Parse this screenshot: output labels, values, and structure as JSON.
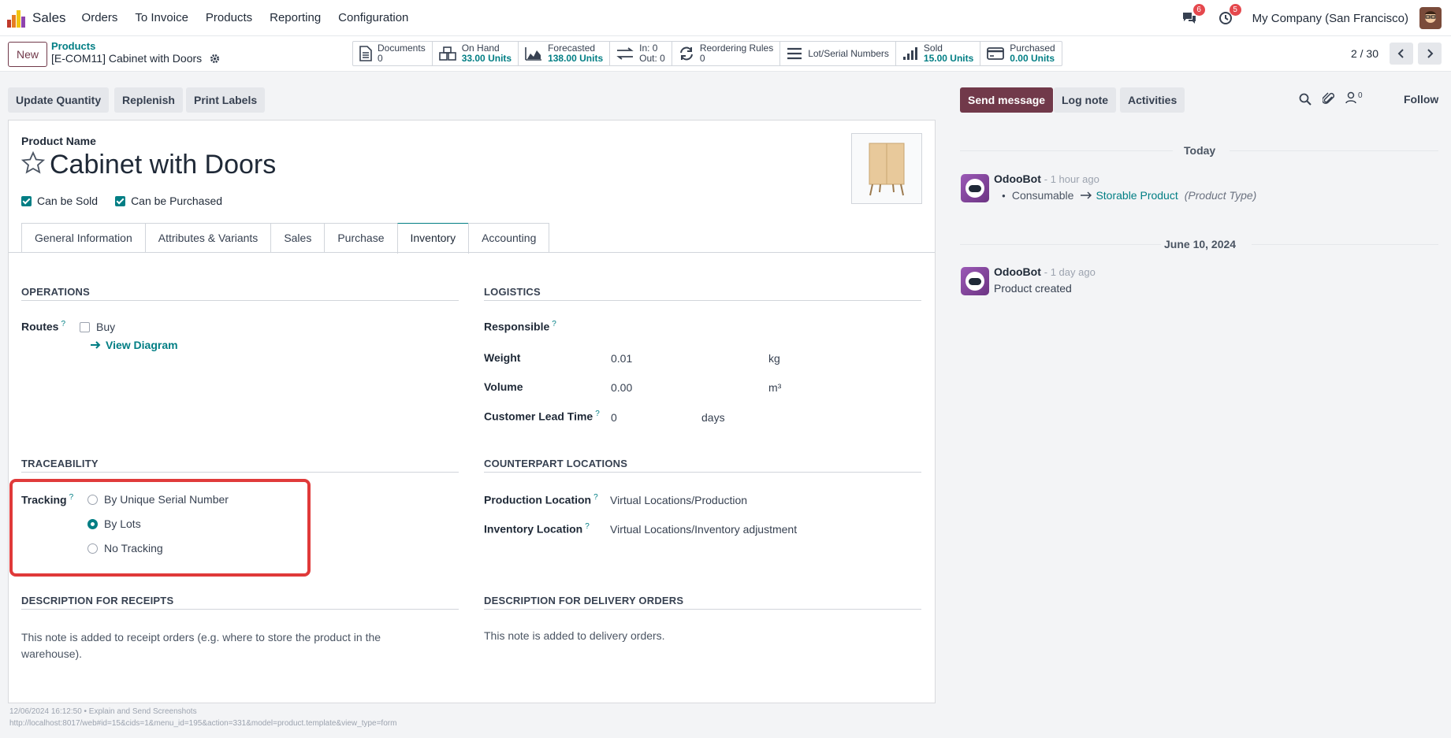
{
  "navbar": {
    "app_name": "Sales",
    "menu": [
      "Orders",
      "To Invoice",
      "Products",
      "Reporting",
      "Configuration"
    ],
    "messages_badge": "6",
    "activities_badge": "5",
    "company": "My Company (San Francisco)"
  },
  "control": {
    "new_label": "New",
    "breadcrumb_parent": "Products",
    "breadcrumb_current": "[E-COM11] Cabinet with Doors",
    "smart_buttons": {
      "documents": {
        "label": "Documents",
        "value": "0"
      },
      "on_hand": {
        "label": "On Hand",
        "value": "33.00 Units"
      },
      "forecasted": {
        "label": "Forecasted",
        "value": "138.00 Units"
      },
      "in_out": {
        "in": "In: 0",
        "out": "Out: 0"
      },
      "reordering": {
        "label": "Reordering Rules",
        "value": "0"
      },
      "lots": {
        "label": "Lot/Serial Numbers"
      },
      "sold": {
        "label": "Sold",
        "value": "15.00 Units"
      },
      "purchased": {
        "label": "Purchased",
        "value": "0.00 Units"
      }
    },
    "pager": "2 / 30"
  },
  "actions": {
    "update_quantity": "Update Quantity",
    "replenish": "Replenish",
    "print_labels": "Print Labels"
  },
  "form": {
    "product_name_label": "Product Name",
    "product_name": "Cabinet with Doors",
    "can_be_sold": "Can be Sold",
    "can_be_purchased": "Can be Purchased",
    "tabs": [
      "General Information",
      "Attributes & Variants",
      "Sales",
      "Purchase",
      "Inventory",
      "Accounting"
    ],
    "active_tab": "Inventory",
    "operations": {
      "title": "OPERATIONS",
      "routes_label": "Routes",
      "route_buy": "Buy",
      "view_diagram": "View Diagram"
    },
    "logistics": {
      "title": "LOGISTICS",
      "responsible_label": "Responsible",
      "weight_label": "Weight",
      "weight_value": "0.01",
      "weight_unit": "kg",
      "volume_label": "Volume",
      "volume_value": "0.00",
      "volume_unit": "m³",
      "lead_time_label": "Customer Lead Time",
      "lead_time_value": "0",
      "lead_time_unit": "days"
    },
    "traceability": {
      "title": "TRACEABILITY",
      "tracking_label": "Tracking",
      "options": [
        "By Unique Serial Number",
        "By Lots",
        "No Tracking"
      ],
      "selected": "By Lots"
    },
    "counterpart": {
      "title": "COUNTERPART LOCATIONS",
      "production_label": "Production Location",
      "production_value": "Virtual Locations/Production",
      "inventory_label": "Inventory Location",
      "inventory_value": "Virtual Locations/Inventory adjustment"
    },
    "desc_receipts": {
      "title": "DESCRIPTION FOR RECEIPTS",
      "text": "This note is added to receipt orders (e.g. where to store the product in the warehouse)."
    },
    "desc_delivery": {
      "title": "DESCRIPTION FOR DELIVERY ORDERS",
      "text": "This note is added to delivery orders."
    }
  },
  "chatter": {
    "send_message": "Send message",
    "log_note": "Log note",
    "activities": "Activities",
    "followers_count": "0",
    "follow": "Follow",
    "groups": [
      {
        "date": "Today",
        "author": "OdooBot",
        "time": "- 1 hour ago",
        "old_value": "Consumable",
        "new_value": "Storable Product",
        "field": "(Product Type)"
      },
      {
        "date": "June 10, 2024",
        "author": "OdooBot",
        "time": "- 1 day ago",
        "body": "Product created"
      }
    ]
  },
  "footer": {
    "line1": "12/06/2024 16:12:50 • Explain and Send Screenshots",
    "line2": "http://localhost:8017/web#id=15&cids=1&menu_id=195&action=331&model=product.template&view_type=form"
  }
}
